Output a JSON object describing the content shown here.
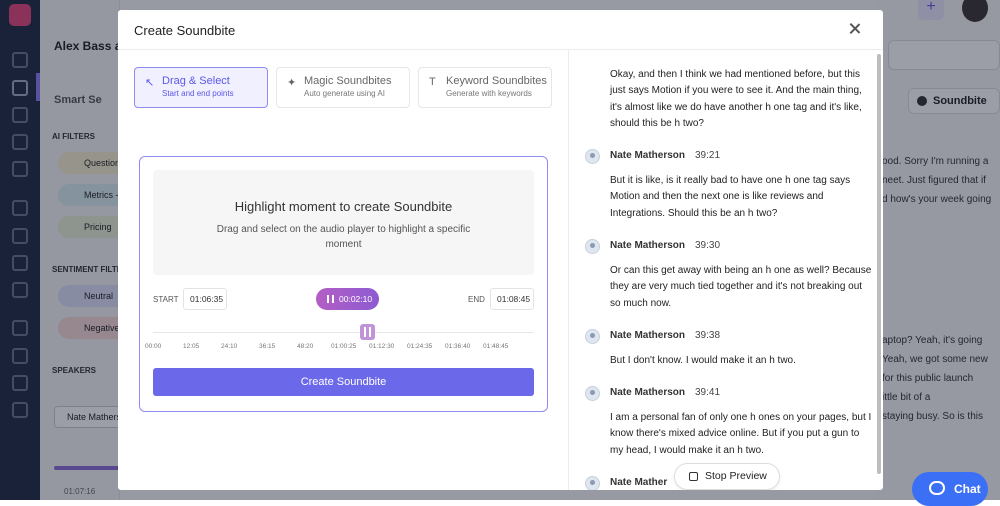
{
  "background": {
    "sidebar": {
      "title": "Alex Bass ar",
      "smart": "Smart Se",
      "ai_filters": "AI FILTERS",
      "filters": [
        "Questions",
        "Metrics -",
        "Pricing"
      ],
      "sentiment": "SENTIMENT FILTE",
      "sentiments": [
        "Neutral",
        "Negative"
      ],
      "speakers": "SPEAKERS",
      "speaker": "Nate Mathers",
      "time": "01:07:16"
    },
    "right": {
      "soundbite": "Soundbite",
      "chat": "Chat",
      "lines_top": [
        "ood. Sorry I'm running a",
        "neet. Just figured that if",
        "d how's your week going"
      ],
      "lines_bottom": [
        "aptop? Yeah, it's going",
        "Yeah, we got some new",
        "for this public launch",
        "ittle bit of a",
        "staying busy. So is this"
      ]
    }
  },
  "modal": {
    "title": "Create Soundbite",
    "modes": [
      {
        "title": "Drag & Select",
        "subtitle": "Start and end points",
        "icon": "cursor-icon",
        "active": true
      },
      {
        "title": "Magic Soundbites",
        "subtitle": "Auto generate using AI",
        "icon": "sparkle-icon",
        "active": false
      },
      {
        "title": "Keyword Soundbites",
        "subtitle": "Generate with keywords",
        "icon": "text-icon",
        "active": false
      }
    ],
    "editor": {
      "heading": "Highlight moment to create Soundbite",
      "description": "Drag and select on the audio player to highlight a specific moment",
      "start_label": "START",
      "start_value": "01:06:35",
      "end_label": "END",
      "end_value": "01:08:45",
      "play_time": "00:02:10",
      "ticks": [
        "00:00",
        "12:05",
        "24:10",
        "36:15",
        "48:20",
        "01:00:25",
        "01:12:30",
        "01:24:35",
        "01:36:40",
        "01:48:45"
      ],
      "create_label": "Create Soundbite"
    },
    "transcript": [
      {
        "speaker": "",
        "time": "",
        "text": "Okay, and then I think we had mentioned before, but this just says Motion if you were to see it. And the main thing, it's almost like we do have another h one tag and it's like, should this be h two?"
      },
      {
        "speaker": "Nate Matherson",
        "time": "39:21",
        "text": "But it is like, is it really bad to have one h one tag says Motion and then the next one is like reviews and Integrations. Should this be an h two?"
      },
      {
        "speaker": "Nate Matherson",
        "time": "39:30",
        "text": "Or can this get away with being an h one as well? Because they are very much tied together and it's not breaking out so much now."
      },
      {
        "speaker": "Nate Matherson",
        "time": "39:38",
        "text": "But I don't know. I would make it an h two."
      },
      {
        "speaker": "Nate Matherson",
        "time": "39:41",
        "text": "I am a personal fan of only one h ones on your pages, but I know there's mixed advice online. But if you put a gun to my head, I would make it an h two."
      },
      {
        "speaker": "Nate Mather",
        "time": "",
        "text": ""
      }
    ],
    "stop_preview": "Stop Preview"
  },
  "colors": {
    "accent": "#6b68ea",
    "accent_light": "#f0f0fe",
    "play": "#b35ec4",
    "sidebar_dark": "#1f2a44",
    "chat": "#3b6ff5"
  }
}
